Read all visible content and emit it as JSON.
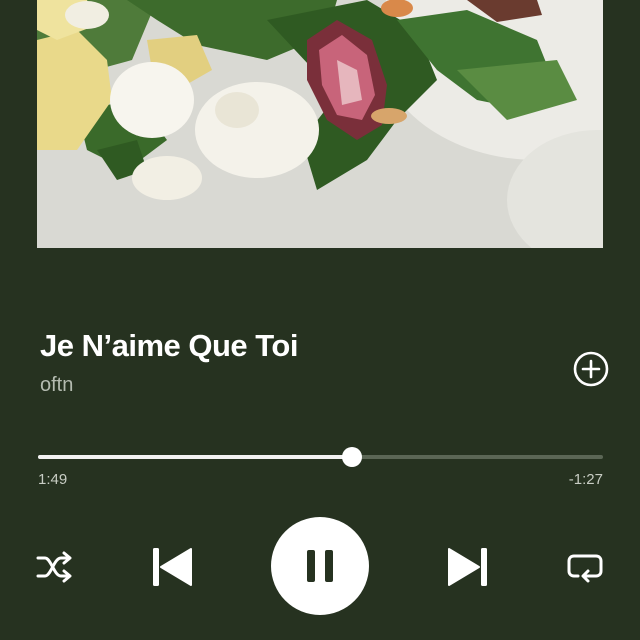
{
  "album_art": {
    "icon": "album-art-image",
    "description_colors": [
      "#dcdcd6",
      "#3a6a2a",
      "#f7f5ee",
      "#b34a5c"
    ]
  },
  "track": {
    "title": "Je N’aime Que Toi",
    "artist": "oftn"
  },
  "playback": {
    "elapsed": "1:49",
    "remaining": "-1:27",
    "progress_fraction": 0.555,
    "state": "playing"
  },
  "icons": {
    "add": "plus-circle-icon",
    "shuffle": "shuffle-icon",
    "previous": "skip-previous-icon",
    "pause": "pause-icon",
    "next": "skip-next-icon",
    "repeat": "repeat-icon"
  },
  "colors": {
    "background": "#263220",
    "accent": "#ffffff",
    "secondary_text": "#b4bbb0"
  }
}
